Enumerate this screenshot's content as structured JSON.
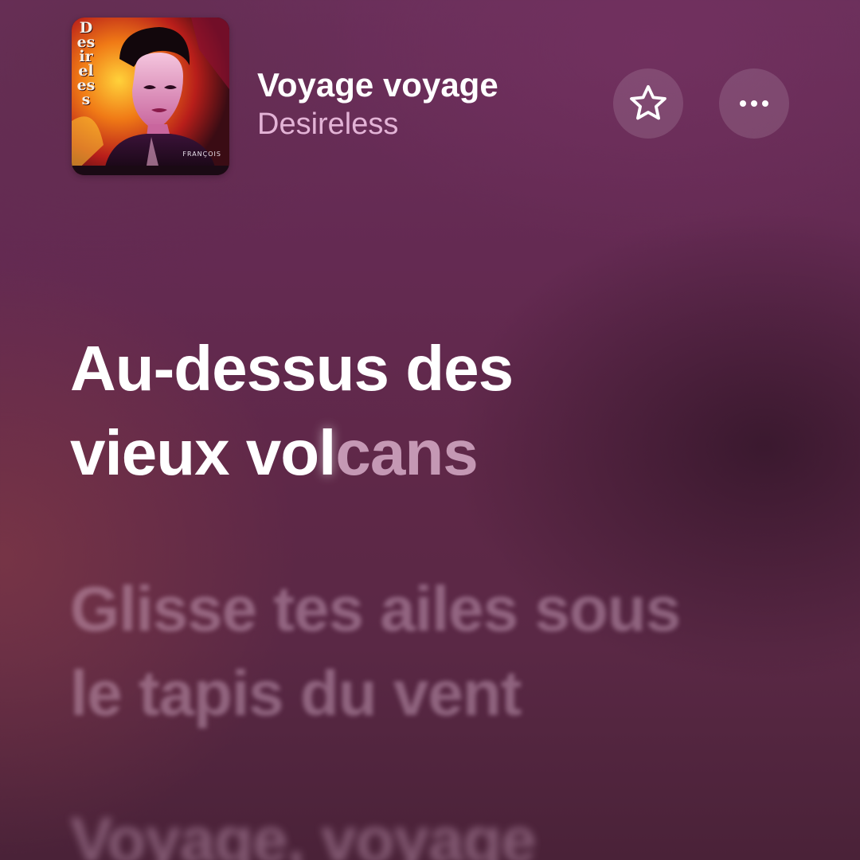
{
  "now_playing": {
    "title": "Voyage voyage",
    "artist": "Desireless",
    "album_art": {
      "band_text": "Desireless",
      "credit_text": "FRANÇOIS"
    }
  },
  "controls": {
    "favorite_icon": "star-outline-icon",
    "more_icon": "ellipsis-icon"
  },
  "lyrics": {
    "current": {
      "line1": "Au-dessus des",
      "line2_sung_a": "vieux vo",
      "line2_sung_b": "l",
      "line2_unsung": "cans"
    },
    "next": {
      "line1": "Glisse tes ailes sous",
      "line2": "le tapis du vent"
    },
    "after": {
      "line1": "Voyage, voyage"
    }
  },
  "colors": {
    "background": "#5f2848",
    "artist_text": "#e3b3d6",
    "active_lyric": "#ffffff"
  }
}
